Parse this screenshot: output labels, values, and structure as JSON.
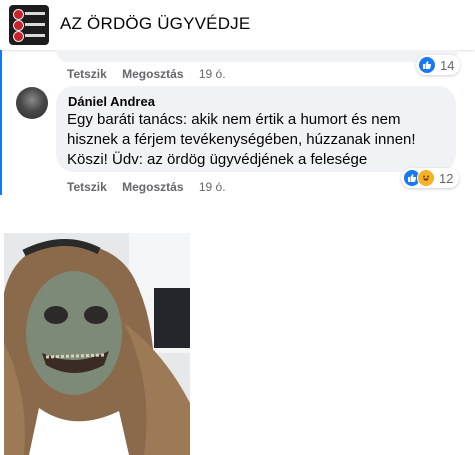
{
  "header": {
    "title": "AZ ÖRDÖG ÜGYVÉDJE",
    "thumb_lines": [
      "Ördö",
      "feles",
      "KORM"
    ]
  },
  "prev_comment": {
    "actions": {
      "like": "Tetszik",
      "share": "Megosztás",
      "time": "19 ó."
    },
    "reactions": {
      "count": "14",
      "icons": [
        "like-icon"
      ]
    }
  },
  "comment": {
    "author": "Dániel Andrea",
    "text": "Egy baráti tanács: akik nem értik a humort és nem hisznek a férjem tevékenységében, húzzanak innen! Köszi! Üdv: az ördög ügyvédjének a felesége",
    "actions": {
      "like": "Tetszik",
      "share": "Megosztás",
      "time": "19 ó."
    },
    "reactions": {
      "count": "12",
      "icons": [
        "like-icon",
        "haha-icon"
      ]
    }
  },
  "colors": {
    "accent": "#1877f2",
    "bubble": "#f0f2f5",
    "meta": "#65676b"
  }
}
